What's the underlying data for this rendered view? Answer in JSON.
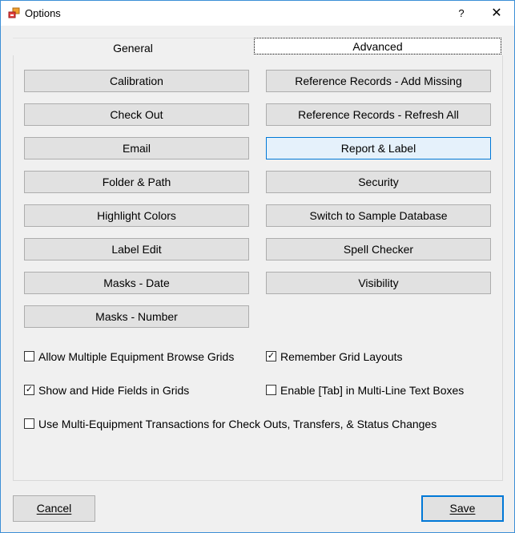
{
  "window": {
    "title": "Options",
    "help_label": "?",
    "close_label": "✕"
  },
  "tabs": [
    {
      "label": "General"
    },
    {
      "label": "Advanced"
    }
  ],
  "buttons_left": [
    {
      "label": "Calibration"
    },
    {
      "label": "Check Out"
    },
    {
      "label": "Email"
    },
    {
      "label": "Folder & Path"
    },
    {
      "label": "Highlight Colors"
    },
    {
      "label": "Label Edit"
    },
    {
      "label": "Masks - Date"
    },
    {
      "label": "Masks - Number"
    }
  ],
  "buttons_right": [
    {
      "label": "Reference Records - Add Missing"
    },
    {
      "label": "Reference Records - Refresh All"
    },
    {
      "label": "Report & Label"
    },
    {
      "label": "Security"
    },
    {
      "label": "Switch to Sample Database"
    },
    {
      "label": "Spell Checker"
    },
    {
      "label": "Visibility"
    }
  ],
  "checkboxes": [
    {
      "label": "Allow Multiple Equipment Browse Grids",
      "checked": false,
      "mark": ""
    },
    {
      "label": "Remember Grid Layouts",
      "checked": true,
      "mark": "✓"
    },
    {
      "label": "Show and Hide Fields in Grids",
      "checked": true,
      "mark": "✓"
    },
    {
      "label": "Enable [Tab] in Multi-Line Text Boxes",
      "checked": false,
      "mark": ""
    },
    {
      "label": "Use Multi-Equipment Transactions for Check Outs, Transfers, & Status Changes",
      "checked": false,
      "mark": ""
    }
  ],
  "footer": {
    "cancel_label": "Cancel",
    "save_label": "Save"
  },
  "colors": {
    "accent": "#0078d7",
    "hover_bg": "#e5f1fb",
    "button_bg": "#e1e1e1"
  }
}
